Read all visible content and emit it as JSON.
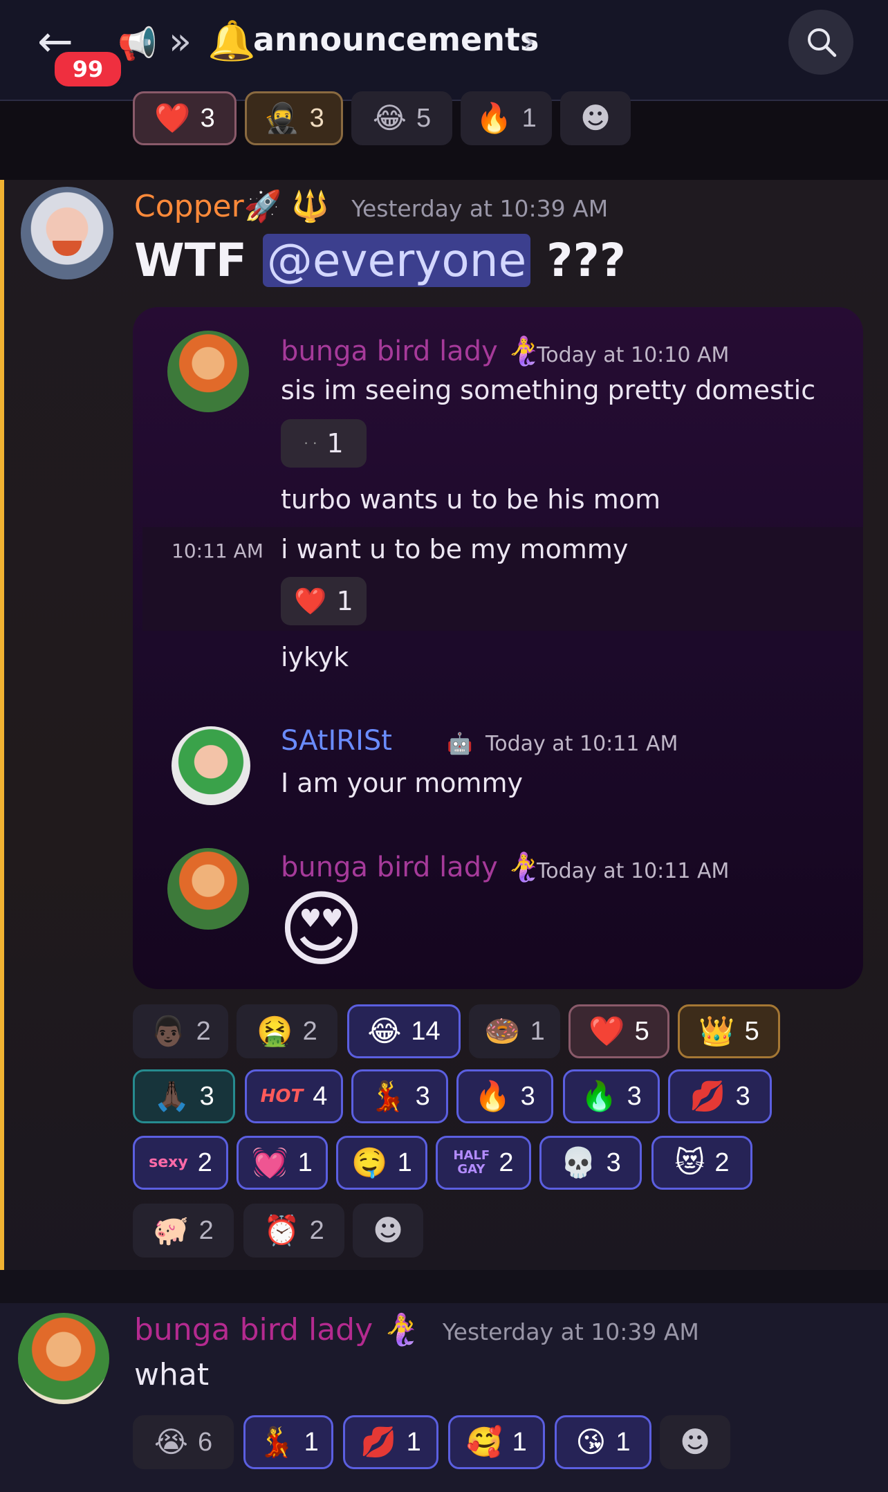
{
  "header": {
    "back_icon": "arrow-left-icon",
    "badge_count": "99",
    "channel_icon": "megaphone-icon",
    "channel_name": "announcements",
    "search_icon": "search-icon"
  },
  "top_reactions": [
    {
      "emoji": "❤️",
      "count": "3",
      "style": "pink"
    },
    {
      "emoji": "🥷",
      "count": "3",
      "style": "brown"
    },
    {
      "emoji": "😂",
      "count": "5",
      "style": "plain"
    },
    {
      "emoji": "🔥",
      "count": "1",
      "style": "plain"
    }
  ],
  "message": {
    "author": "Copper🚀 🔱",
    "timestamp": "Yesterday at 10:39 AM",
    "text_prefix": "WTF",
    "mention": "@everyone",
    "text_suffix": "???",
    "embed": {
      "posts": [
        {
          "author": "bunga bird lady 🧜‍♀️",
          "timestamp": "Today at 10:10 AM"
        },
        {
          "author": "SAtIRISt",
          "timestamp": "Today at 10:11 AM"
        },
        {
          "author": "bunga bird lady 🧜‍♀️",
          "timestamp": "Today at 10:11 AM"
        }
      ],
      "lines": [
        "sis im seeing something pretty domestic",
        "turbo wants u to be his mom",
        "i want u to be my mommy",
        "iykyk",
        "I am your mommy"
      ],
      "hover_time": "10:11 AM",
      "rx1_count": "1",
      "rx2_emoji": "❤️",
      "rx2_count": "1",
      "big_emoji": "😍"
    },
    "reactions": [
      {
        "emoji": "👨🏿",
        "count": "2",
        "style": "plain"
      },
      {
        "emoji": "🤮",
        "count": "2",
        "style": "plain"
      },
      {
        "emoji": "😂",
        "count": "14",
        "style": "blue"
      },
      {
        "emoji": "🍩",
        "count": "1",
        "style": "plain"
      },
      {
        "emoji": "❤️",
        "count": "5",
        "style": "pink"
      },
      {
        "emoji": "👑",
        "count": "5",
        "style": "gold"
      },
      {
        "emoji": "🙏🏿",
        "count": "3",
        "style": "teal"
      },
      {
        "emoji": "HOT",
        "count": "4",
        "style": "blue"
      },
      {
        "emoji": "💃",
        "count": "3",
        "style": "blue"
      },
      {
        "emoji": "🔥",
        "count": "3",
        "style": "blue"
      },
      {
        "emoji": "🔥",
        "count": "3",
        "style": "blue"
      },
      {
        "emoji": "💋",
        "count": "3",
        "style": "blue"
      },
      {
        "emoji": "sexy",
        "count": "2",
        "style": "blue"
      },
      {
        "emoji": "💓",
        "count": "1",
        "style": "blue"
      },
      {
        "emoji": "🤤",
        "count": "1",
        "style": "blue"
      },
      {
        "emoji": "HALF GAY",
        "count": "2",
        "style": "blue"
      },
      {
        "emoji": "💀",
        "count": "3",
        "style": "blue"
      },
      {
        "emoji": "😻",
        "count": "2",
        "style": "blue"
      },
      {
        "emoji": "🐖",
        "count": "2",
        "style": "plain"
      },
      {
        "emoji": "⏰",
        "count": "2",
        "style": "plain"
      }
    ]
  },
  "next_message": {
    "author": "bunga bird lady 🧜‍♀️",
    "timestamp": "Yesterday at 10:39 AM",
    "text": "what",
    "reactions": [
      {
        "emoji": "😭",
        "count": "6",
        "style": "plain"
      },
      {
        "emoji": "💃",
        "count": "1",
        "style": "blue"
      },
      {
        "emoji": "💋",
        "count": "1",
        "style": "blue"
      },
      {
        "emoji": "🥰",
        "count": "1",
        "style": "blue"
      },
      {
        "emoji": "😘",
        "count": "1",
        "style": "blue"
      }
    ]
  },
  "add_reaction_icon": "add-reaction-icon"
}
